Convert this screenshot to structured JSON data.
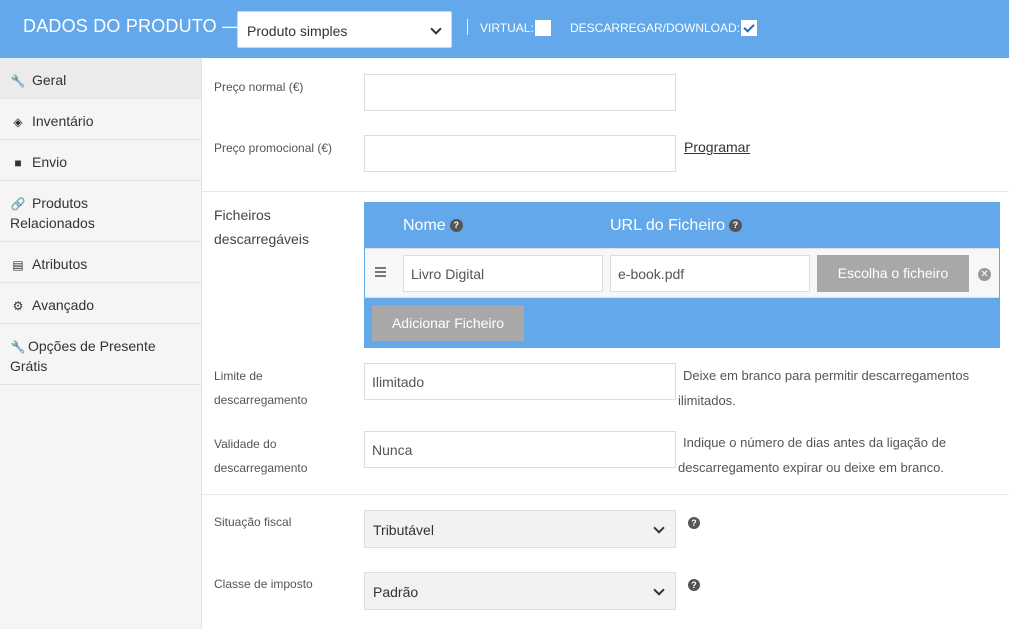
{
  "header": {
    "title": "DADOS DO PRODUTO —",
    "product_type": "Produto simples",
    "virtual_label": "VIRTUAL:",
    "virtual_checked": false,
    "download_label": "DESCARREGAR/DOWNLOAD:",
    "download_checked": true
  },
  "sidebar": {
    "items": [
      {
        "label": "Geral",
        "icon": "wrench-icon",
        "active": true
      },
      {
        "label": "Inventário",
        "icon": "tag-icon",
        "active": false
      },
      {
        "label": "Envio",
        "icon": "truck-icon",
        "active": false
      },
      {
        "label": "Produtos",
        "label2": "Relacionados",
        "icon": "link-icon",
        "active": false
      },
      {
        "label": "Atributos",
        "icon": "list-icon",
        "active": false
      },
      {
        "label": "Avançado",
        "icon": "gear-icon",
        "active": false
      },
      {
        "label": "Opções de Presente",
        "label2": "Grátis",
        "icon": "wrench-icon",
        "active": false
      }
    ]
  },
  "form": {
    "regular_price_label": "Preço normal (€)",
    "regular_price_value": "",
    "sale_price_label": "Preço promocional (€)",
    "sale_price_value": "",
    "schedule_link": "Programar",
    "downloadable_files_label1": "Ficheiros",
    "downloadable_files_label2": "descarregáveis",
    "files_table": {
      "col_name": "Nome",
      "col_url": "URL do Ficheiro",
      "rows": [
        {
          "name": "Livro Digital",
          "url": "e-book.pdf",
          "choose_button": "Escolha o ficheiro"
        }
      ],
      "add_button": "Adicionar Ficheiro"
    },
    "download_limit_label1": "Limite de",
    "download_limit_label2": "descarregamento",
    "download_limit_placeholder": "Ilimitado",
    "download_limit_hint1": "Deixe em branco para permitir descarregamentos",
    "download_limit_hint2": "ilimitados.",
    "download_expiry_label1": "Validade do",
    "download_expiry_label2": "descarregamento",
    "download_expiry_placeholder": "Nunca",
    "download_expiry_hint1": "Indique o número de dias antes da ligação de",
    "download_expiry_hint2": "descarregamento expirar ou deixe em branco.",
    "tax_status_label": "Situação fiscal",
    "tax_status_value": "Tributável",
    "tax_class_label": "Classe de imposto",
    "tax_class_value": "Padrão"
  },
  "colors": {
    "header_bg": "#62a8ea",
    "button_grey": "#a8a8a8"
  }
}
